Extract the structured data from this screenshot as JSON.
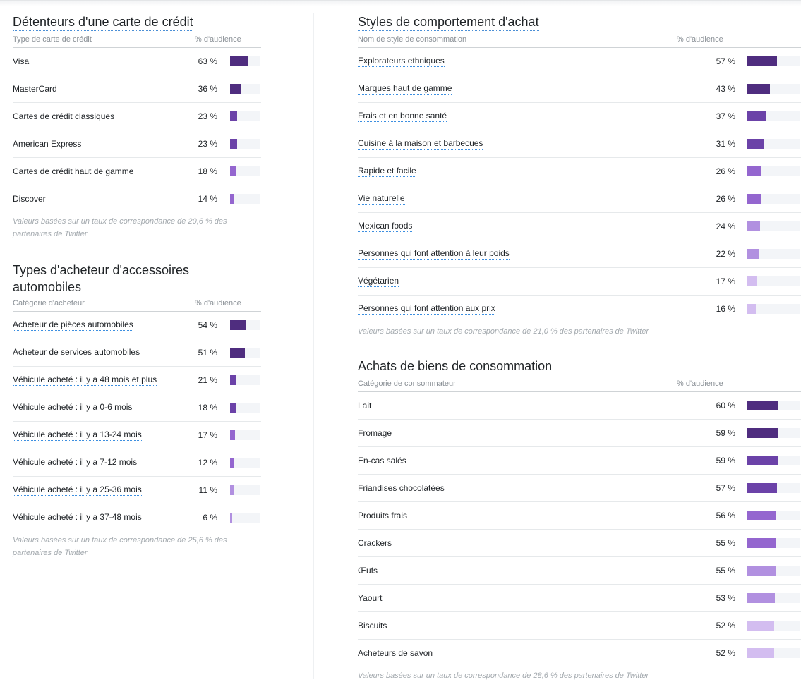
{
  "panels": [
    {
      "id": "credit",
      "title": "Détenteurs d'une carte de crédit",
      "col1": "Type de carte de crédit",
      "col2": "% d'audience",
      "note": "Valeurs basées sur un taux de correspondance de 20,6 % des partenaires de Twitter",
      "rows": [
        {
          "label": "Visa",
          "value": 63,
          "pct": "63 %",
          "underlined": false
        },
        {
          "label": "MasterCard",
          "value": 36,
          "pct": "36 %",
          "underlined": false
        },
        {
          "label": "Cartes de crédit classiques",
          "value": 23,
          "pct": "23 %",
          "underlined": false
        },
        {
          "label": "American Express",
          "value": 23,
          "pct": "23 %",
          "underlined": false
        },
        {
          "label": "Cartes de crédit haut de gamme",
          "value": 18,
          "pct": "18 %",
          "underlined": false
        },
        {
          "label": "Discover",
          "value": 14,
          "pct": "14 %",
          "underlined": false
        }
      ]
    },
    {
      "id": "auto",
      "title": "Types d'acheteur d'accessoires automobiles",
      "col1": "Catégorie d'acheteur",
      "col2": "% d'audience",
      "note": "Valeurs basées sur un taux de correspondance de 25,6 % des partenaires de Twitter",
      "rows": [
        {
          "label": "Acheteur de pièces automobiles",
          "value": 54,
          "pct": "54 %",
          "underlined": true
        },
        {
          "label": "Acheteur de services automobiles",
          "value": 51,
          "pct": "51 %",
          "underlined": true
        },
        {
          "label": "Véhicule acheté : il y a 48 mois et plus",
          "value": 21,
          "pct": "21 %",
          "underlined": true
        },
        {
          "label": "Véhicule acheté : il y a 0-6 mois",
          "value": 18,
          "pct": "18 %",
          "underlined": true
        },
        {
          "label": "Véhicule acheté : il y a 13-24 mois",
          "value": 17,
          "pct": "17 %",
          "underlined": true
        },
        {
          "label": "Véhicule acheté : il y a 7-12 mois",
          "value": 12,
          "pct": "12 %",
          "underlined": true
        },
        {
          "label": "Véhicule acheté : il y a 25-36 mois",
          "value": 11,
          "pct": "11 %",
          "underlined": true
        },
        {
          "label": "Véhicule acheté : il y a 37-48 mois",
          "value": 6,
          "pct": "6 %",
          "underlined": true
        }
      ]
    },
    {
      "id": "styles",
      "title": "Styles de comportement d'achat",
      "col1": "Nom de style de consommation",
      "col2": "% d'audience",
      "note": "Valeurs basées sur un taux de correspondance de 21,0 % des partenaires de Twitter",
      "rows": [
        {
          "label": "Explorateurs ethniques",
          "value": 57,
          "pct": "57 %",
          "underlined": true
        },
        {
          "label": "Marques haut de gamme",
          "value": 43,
          "pct": "43 %",
          "underlined": true
        },
        {
          "label": "Frais et en bonne santé",
          "value": 37,
          "pct": "37 %",
          "underlined": true
        },
        {
          "label": "Cuisine à la maison et barbecues",
          "value": 31,
          "pct": "31 %",
          "underlined": true
        },
        {
          "label": "Rapide et facile",
          "value": 26,
          "pct": "26 %",
          "underlined": true
        },
        {
          "label": "Vie naturelle",
          "value": 26,
          "pct": "26 %",
          "underlined": true
        },
        {
          "label": "Mexican foods",
          "value": 24,
          "pct": "24 %",
          "underlined": true
        },
        {
          "label": "Personnes qui font attention à leur poids",
          "value": 22,
          "pct": "22 %",
          "underlined": true
        },
        {
          "label": "Végétarien",
          "value": 17,
          "pct": "17 %",
          "underlined": true
        },
        {
          "label": "Personnes qui font attention aux prix",
          "value": 16,
          "pct": "16 %",
          "underlined": true
        }
      ]
    },
    {
      "id": "goods",
      "title": "Achats de biens de consommation",
      "col1": "Catégorie de consommateur",
      "col2": "% d'audience",
      "note": "Valeurs basées sur un taux de correspondance de 28,6 % des partenaires de Twitter",
      "rows": [
        {
          "label": "Lait",
          "value": 60,
          "pct": "60 %",
          "underlined": false
        },
        {
          "label": "Fromage",
          "value": 59,
          "pct": "59 %",
          "underlined": false
        },
        {
          "label": "En-cas salés",
          "value": 59,
          "pct": "59 %",
          "underlined": false
        },
        {
          "label": "Friandises chocolatées",
          "value": 57,
          "pct": "57 %",
          "underlined": false
        },
        {
          "label": "Produits frais",
          "value": 56,
          "pct": "56 %",
          "underlined": false
        },
        {
          "label": "Crackers",
          "value": 55,
          "pct": "55 %",
          "underlined": false
        },
        {
          "label": "Œufs",
          "value": 55,
          "pct": "55 %",
          "underlined": false
        },
        {
          "label": "Yaourt",
          "value": 53,
          "pct": "53 %",
          "underlined": false
        },
        {
          "label": "Biscuits",
          "value": 52,
          "pct": "52 %",
          "underlined": false
        },
        {
          "label": "Acheteurs de savon",
          "value": 52,
          "pct": "52 %",
          "underlined": false
        }
      ]
    }
  ],
  "colors": {
    "rank": [
      "#4f2d7f",
      "#4f2d7f",
      "#6b42a8",
      "#6b42a8",
      "#9466cf",
      "#9466cf",
      "#b190e0",
      "#b190e0",
      "#d3bdf0",
      "#d3bdf0"
    ],
    "track": "#f3f5f8"
  }
}
